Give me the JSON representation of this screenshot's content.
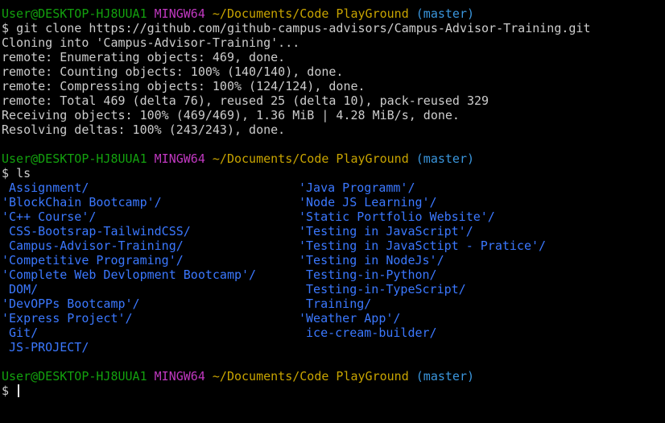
{
  "prompt": {
    "user_host": "User@DESKTOP-HJ8UUA1",
    "system": "MINGW64",
    "path": "~/Documents/Code PlayGround",
    "branch": "(master)",
    "symbol": "$"
  },
  "session": {
    "cmd1": "git clone https://github.com/github-campus-advisors/Campus-Advisor-Training.git",
    "output1": [
      "Cloning into 'Campus-Advisor-Training'...",
      "remote: Enumerating objects: 469, done.",
      "remote: Counting objects: 100% (140/140), done.",
      "remote: Compressing objects: 100% (124/124), done.",
      "remote: Total 469 (delta 76), reused 25 (delta 10), pack-reused 329",
      "Receiving objects: 100% (469/469), 1.36 MiB | 4.28 MiB/s, done.",
      "Resolving deltas: 100% (243/243), done."
    ],
    "cmd2": "ls"
  },
  "ls": {
    "rows": [
      [
        " Assignment/",
        "'Java Programm'/"
      ],
      [
        "'BlockChain Bootcamp'/",
        "'Node JS Learning'/"
      ],
      [
        "'C++ Course'/",
        "'Static Portfolio Website'/"
      ],
      [
        " CSS-Bootsrap-TailwindCSS/",
        "'Testing in JavaScript'/"
      ],
      [
        " Campus-Advisor-Training/",
        "'Testing in JavaSctipt - Pratice'/"
      ],
      [
        "'Competitive Programing'/",
        "'Testing in NodeJs'/"
      ],
      [
        "'Complete Web Devlopment Bootcamp'/",
        " Testing-in-Python/"
      ],
      [
        " DOM/",
        " Testing-in-TypeScript/"
      ],
      [
        "'DevOPPs Bootcamp'/",
        " Training/"
      ],
      [
        "'Express Project'/",
        "'Weather App'/"
      ],
      [
        " Git/",
        " ice-cream-builder/"
      ],
      [
        " JS-PROJECT/",
        ""
      ]
    ]
  }
}
